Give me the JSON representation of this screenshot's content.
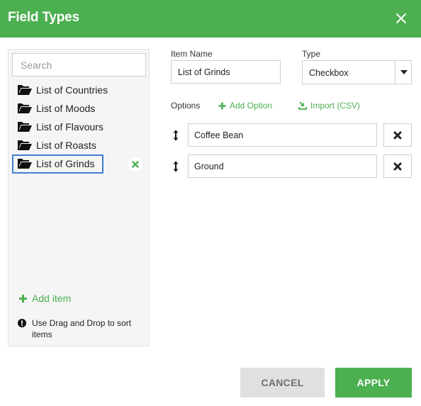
{
  "dialog": {
    "title": "Field Types"
  },
  "colors": {
    "accent": "#4caf50",
    "selection_border": "#3f7fd0",
    "cancel_bg": "#e0e0e0"
  },
  "sidebar": {
    "search_placeholder": "Search",
    "items": [
      {
        "label": "List of Countries",
        "icon": "folder-open-icon"
      },
      {
        "label": "List of Moods",
        "icon": "folder-open-icon"
      },
      {
        "label": "List of Flavours",
        "icon": "folder-open-icon"
      },
      {
        "label": "List of Roasts",
        "icon": "folder-open-icon"
      },
      {
        "label": "List of Grinds",
        "icon": "folder-open-icon",
        "selected": true
      }
    ],
    "add_item_label": "Add item",
    "hint": "Use Drag and Drop to sort items"
  },
  "form": {
    "item_name_label": "Item Name",
    "item_name_value": "List of Grinds",
    "type_label": "Type",
    "type_value": "Checkbox",
    "options_label": "Options",
    "add_option_label": "Add Option",
    "import_label": "Import (CSV)",
    "options": [
      {
        "value": "Coffee Bean"
      },
      {
        "value": "Ground"
      }
    ]
  },
  "footer": {
    "cancel_label": "CANCEL",
    "apply_label": "APPLY"
  }
}
